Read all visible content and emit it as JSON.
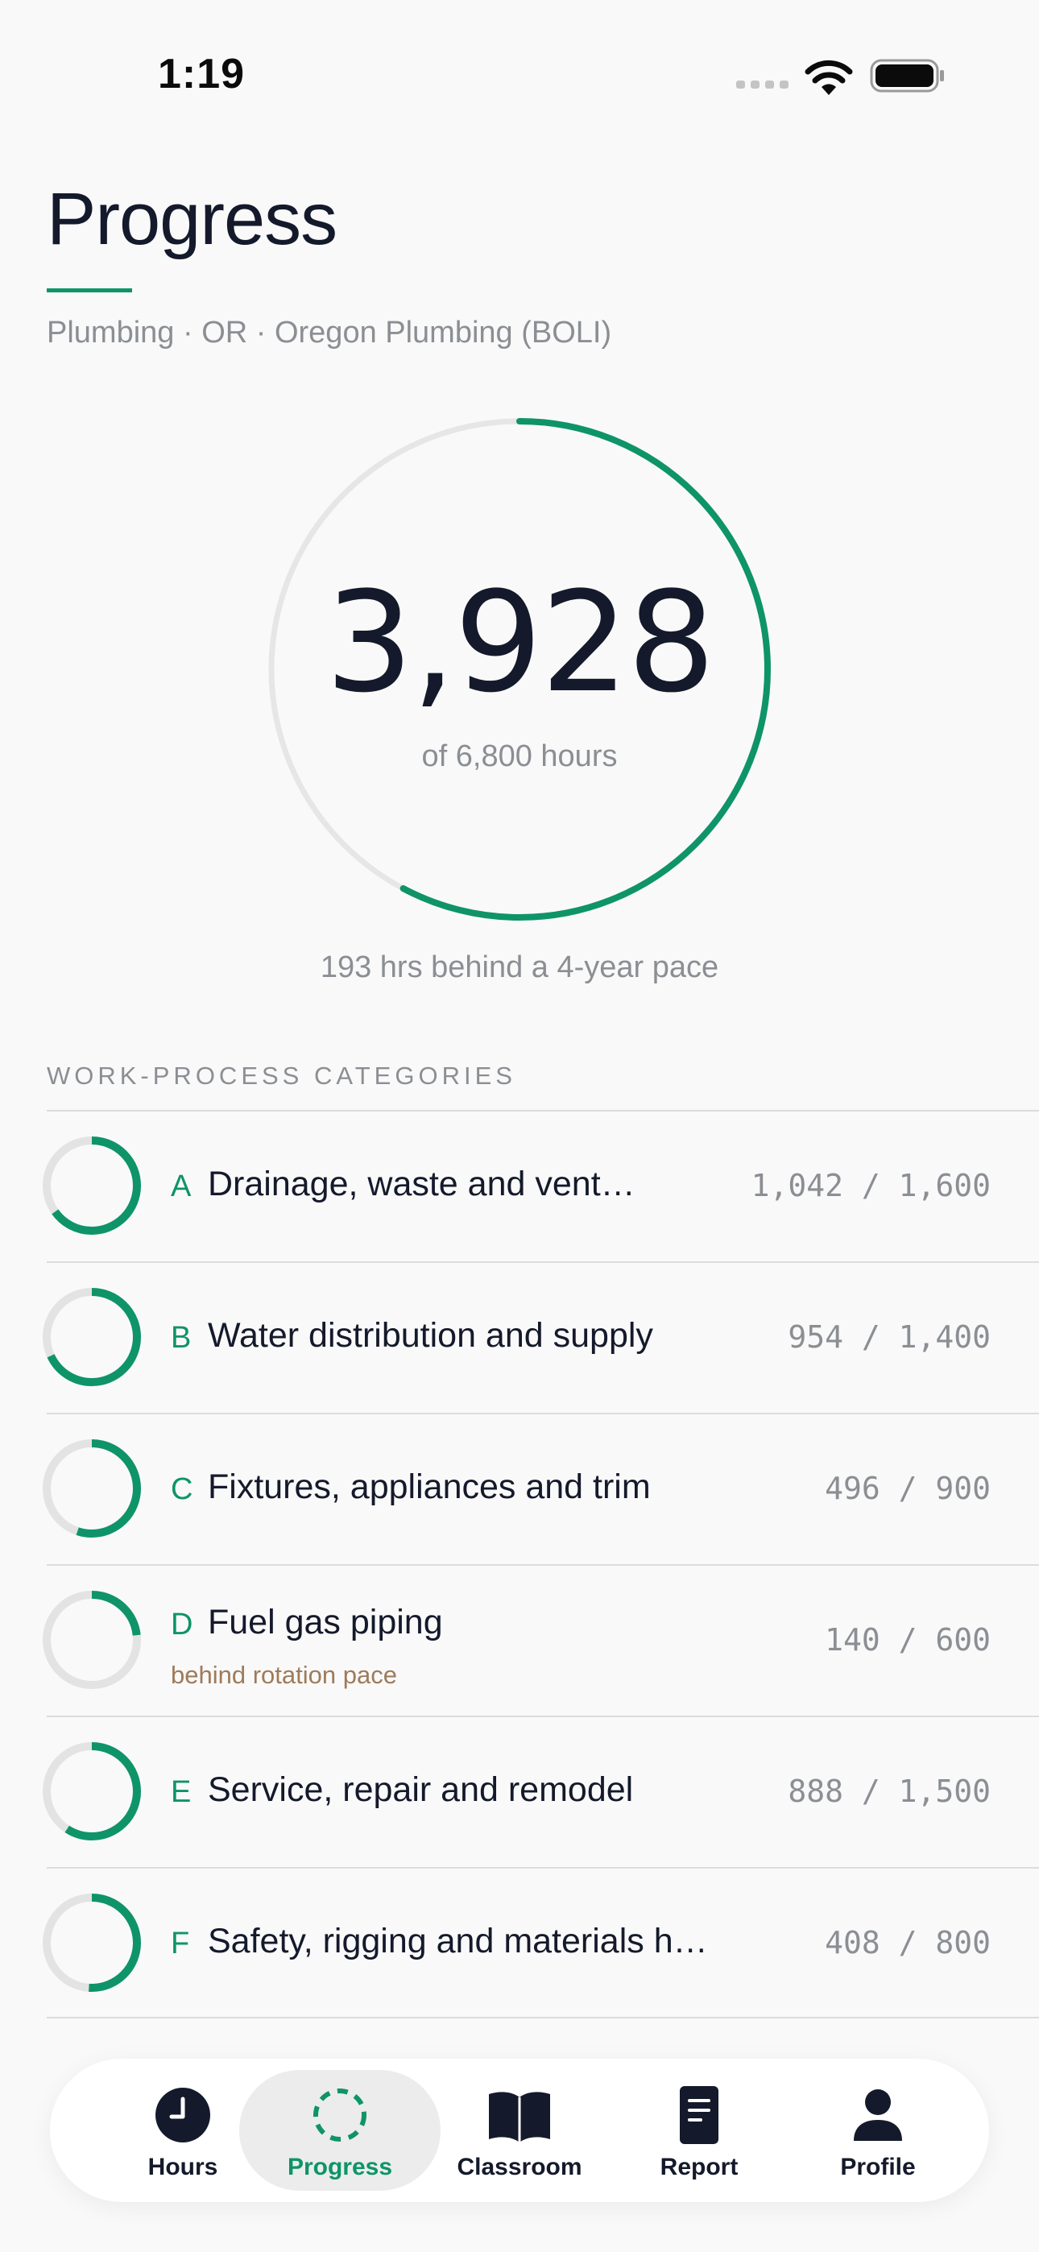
{
  "status_bar": {
    "time": "1:19"
  },
  "header": {
    "title": "Progress",
    "subtitle": "Plumbing · OR · Oregon Plumbing (BOLI)"
  },
  "summary": {
    "completed_hours": "3,928",
    "total_caption": "of 6,800 hours",
    "progress_fraction": 0.5776,
    "pace_note": "193 hrs behind a 4-year pace"
  },
  "categories_section": {
    "label": "WORK-PROCESS CATEGORIES",
    "items": [
      {
        "letter": "A",
        "name": "Drainage, waste and vent…",
        "hours": "1,042 / 1,600",
        "fraction": 0.651,
        "warning": ""
      },
      {
        "letter": "B",
        "name": "Water distribution and supply",
        "hours": "954 / 1,400",
        "fraction": 0.681,
        "warning": ""
      },
      {
        "letter": "C",
        "name": "Fixtures, appliances and trim",
        "hours": "496 / 900",
        "fraction": 0.551,
        "warning": ""
      },
      {
        "letter": "D",
        "name": "Fuel gas piping",
        "hours": "140 / 600",
        "fraction": 0.233,
        "warning": "behind rotation pace"
      },
      {
        "letter": "E",
        "name": "Service, repair and remodel",
        "hours": "888 / 1,500",
        "fraction": 0.592,
        "warning": ""
      },
      {
        "letter": "F",
        "name": "Safety, rigging and materials h…",
        "hours": "408 / 800",
        "fraction": 0.51,
        "warning": ""
      }
    ]
  },
  "tab_bar": {
    "tabs": [
      {
        "label": "Hours",
        "icon": "clock-icon"
      },
      {
        "label": "Progress",
        "icon": "progress-ring-icon"
      },
      {
        "label": "Classroom",
        "icon": "book-icon"
      },
      {
        "label": "Report",
        "icon": "document-icon"
      },
      {
        "label": "Profile",
        "icon": "person-icon"
      }
    ],
    "active_index": 1
  },
  "colors": {
    "accent": "#0e9468",
    "track": "#e6e6e6",
    "warning": "#9e7b5a",
    "text_primary": "#141a2b",
    "text_secondary": "#8b8e93"
  }
}
